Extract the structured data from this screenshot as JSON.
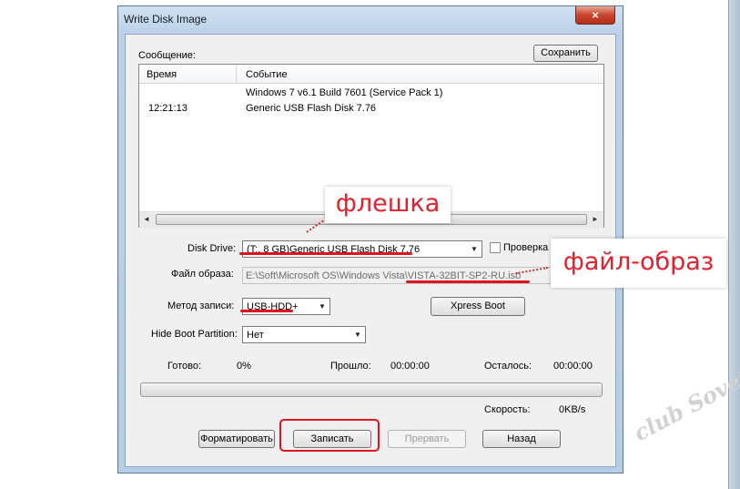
{
  "window": {
    "title": "Write Disk Image",
    "close_glyph": "×"
  },
  "message_section": {
    "label": "Сообщение:",
    "save_button": "Сохранить",
    "columns": [
      "Время",
      "Событие"
    ],
    "rows": [
      {
        "time": "",
        "event": "Windows 7 v6.1 Build 7601 (Service Pack 1)"
      },
      {
        "time": "12:21:13",
        "event": "Generic USB Flash Disk  7.76"
      }
    ],
    "scroll_left": "◄",
    "scroll_right": "►"
  },
  "disk_drive": {
    "label": "Disk Drive:",
    "value": "(T:, 8 GB)Generic USB Flash Disk  7.76"
  },
  "verify": {
    "label": "Проверка",
    "checked": false
  },
  "image_file": {
    "label": "Файл образа:",
    "value": "E:\\Soft\\Microsoft OS\\Windows Vista\\VISTA-32BIT-SP2-RU.iso"
  },
  "write_method": {
    "label": "Метод записи:",
    "value": "USB-HDD+"
  },
  "xpress_boot": {
    "label": "Xpress Boot"
  },
  "hide_boot": {
    "label": "Hide Boot Partition:",
    "value": "Нет"
  },
  "status": {
    "done_label": "Готово:",
    "done_value": "0%",
    "elapsed_label": "Прошло:",
    "elapsed_value": "00:00:00",
    "remaining_label": "Осталось:",
    "remaining_value": "00:00:00",
    "speed_label": "Скорость:",
    "speed_value": "0KB/s",
    "progress": 0
  },
  "buttons": {
    "format": "Форматировать",
    "write": "Записать",
    "abort": "Прервать",
    "back": "Назад"
  },
  "annotations": {
    "flash": "флешка",
    "image": "файл-образ",
    "accent_color": "#e3202b"
  },
  "watermark": {
    "text": "club Sovet"
  }
}
